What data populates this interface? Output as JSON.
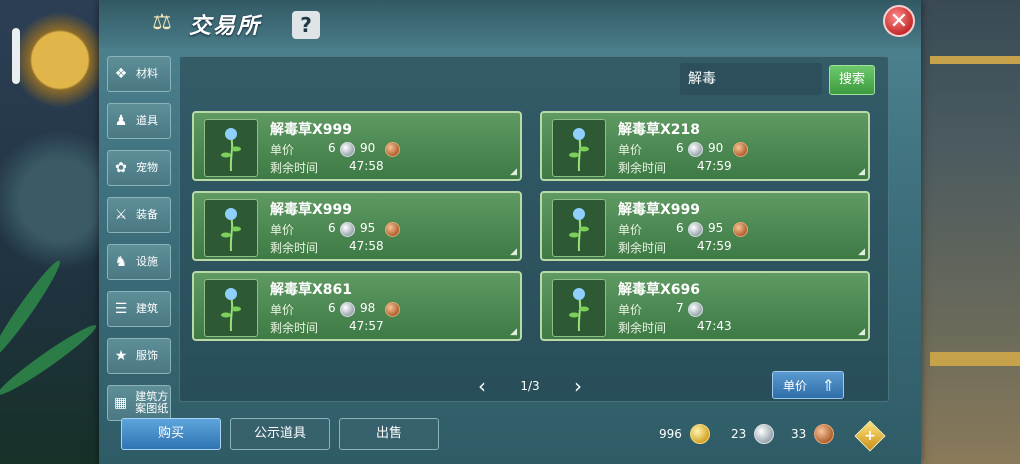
{
  "window": {
    "title": "交易所",
    "help_label": "?",
    "close_label": "✕"
  },
  "sidebar": {
    "items": [
      {
        "label": "材料",
        "icon": "ore-icon"
      },
      {
        "label": "道具",
        "icon": "flask-icon"
      },
      {
        "label": "宠物",
        "icon": "paw-icon"
      },
      {
        "label": "装备",
        "icon": "sword-icon"
      },
      {
        "label": "设施",
        "icon": "horse-icon"
      },
      {
        "label": "建筑",
        "icon": "wall-icon"
      },
      {
        "label": "服饰",
        "icon": "shirt-icon"
      },
      {
        "label": "建筑方案图纸",
        "icon": "blueprint-icon"
      }
    ]
  },
  "search": {
    "value": "解毒",
    "button_label": "搜索"
  },
  "labels": {
    "price": "单价",
    "time_left": "剩余时间"
  },
  "listings": [
    {
      "name": "解毒草X999",
      "silver": "6",
      "copper": "90",
      "time": "47:58"
    },
    {
      "name": "解毒草X218",
      "silver": "6",
      "copper": "90",
      "time": "47:59"
    },
    {
      "name": "解毒草X999",
      "silver": "6",
      "copper": "95",
      "time": "47:58"
    },
    {
      "name": "解毒草X999",
      "silver": "6",
      "copper": "95",
      "time": "47:59"
    },
    {
      "name": "解毒草X861",
      "silver": "6",
      "copper": "98",
      "time": "47:57"
    },
    {
      "name": "解毒草X696",
      "silver": "7",
      "copper": "",
      "time": "47:43"
    }
  ],
  "pagination": {
    "text": "1/3",
    "prev": "‹",
    "next": "›"
  },
  "sort": {
    "label": "单价",
    "arrow": "⇑"
  },
  "bottom_tabs": [
    {
      "label": "购买",
      "active": true
    },
    {
      "label": "公示道具",
      "active": false
    },
    {
      "label": "出售",
      "active": false
    }
  ],
  "wallet": {
    "gold": "996",
    "silver": "23",
    "copper": "33",
    "add_label": "+"
  },
  "colors": {
    "accent_green": "#3e9a3e",
    "accent_blue": "#2f74b2",
    "panel": "#3d6f7c"
  }
}
